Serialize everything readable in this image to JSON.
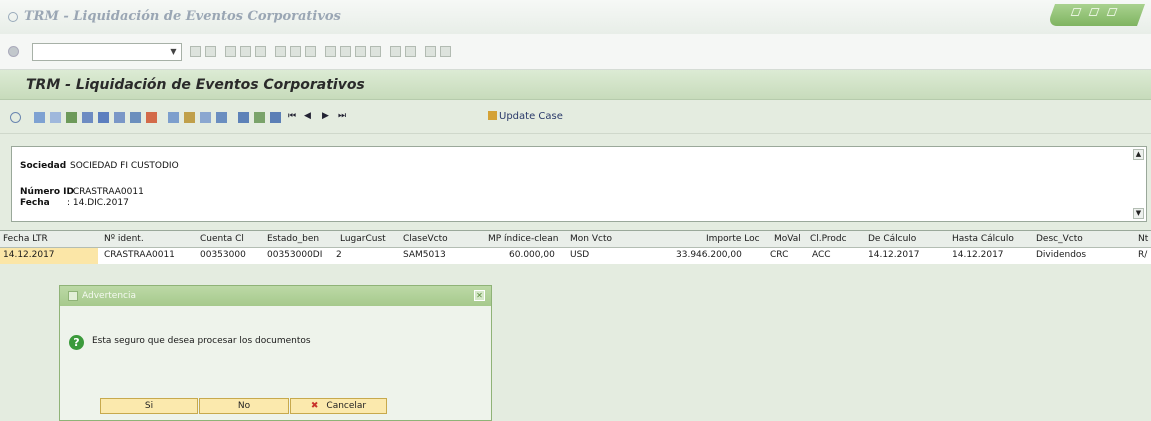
{
  "window": {
    "title": "TRM - Liquidación de Eventos Corporativos"
  },
  "app": {
    "title": "TRM - Liquidación de Eventos Corporativos",
    "toolbar": {
      "update_case": "Update Case"
    }
  },
  "header": {
    "sociedad_label": "Sociedad",
    "sociedad_value": "SOCIEDAD FI CUSTODIO",
    "numero_label": "Número ID",
    "numero_value": ": CRASTRAA0011",
    "fecha_label": "Fecha",
    "fecha_value": ": 14.DIC.2017"
  },
  "table": {
    "columns": [
      "Fecha LTR",
      "Nº ident.",
      "Cuenta Cl",
      "Estado_ben",
      "LugarCust",
      "ClaseVcto",
      "MP índice-clean",
      "Mon Vcto",
      "Importe Loc",
      "MoVal",
      "Cl.Prodc",
      "De Cálculo",
      "Hasta Cálculo",
      "Desc_Vcto",
      "Nt"
    ],
    "rows": [
      [
        "14.12.2017",
        "CRASTRAA0011",
        "00353000",
        "00353000DI",
        "2",
        "SAM5013",
        "60.000,00",
        "USD",
        "33.946.200,00",
        "CRC",
        "ACC",
        "14.12.2017",
        "14.12.2017",
        "Dividendos",
        "R/"
      ]
    ]
  },
  "dialog": {
    "title": "Advertencia",
    "message": "Esta seguro que desea procesar los documentos",
    "btn_yes": "Si",
    "btn_no": "No",
    "btn_cancel": "Cancelar"
  },
  "colors": {
    "accent_green": "#a6c98c",
    "selected_cell": "#fbe6a7",
    "background": "#e4ece0"
  }
}
